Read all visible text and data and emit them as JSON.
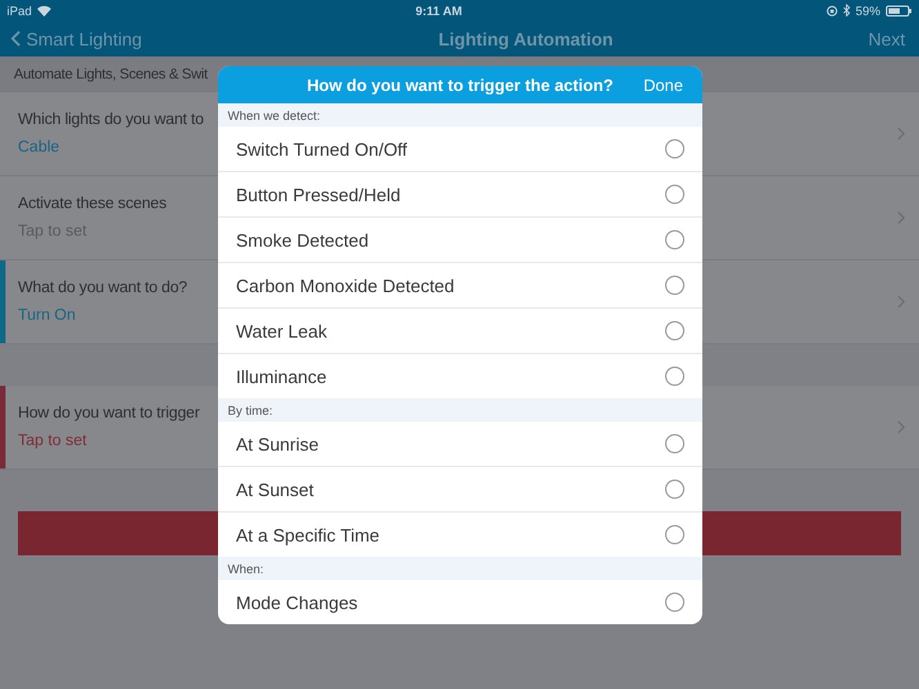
{
  "status_bar": {
    "device": "iPad",
    "time": "9:11 AM",
    "battery": "59%"
  },
  "nav_bar": {
    "back": "Smart Lighting",
    "title": "Lighting Automation",
    "action": "Next"
  },
  "subtitle": "Automate Lights, Scenes & Swit",
  "sections": [
    {
      "rows": [
        {
          "title": "Which lights do you want to",
          "value": "Cable",
          "value_set": true,
          "active": false,
          "error": false
        },
        {
          "title": "Activate these scenes",
          "value": "Tap to set",
          "value_set": false,
          "active": false,
          "error": false
        },
        {
          "title": "What do you want to do?",
          "value": "Turn On",
          "value_set": true,
          "active": true,
          "error": false
        }
      ]
    },
    {
      "rows": [
        {
          "title": "How do you want to trigger",
          "value": "Tap to set",
          "value_set": false,
          "active": false,
          "error": true
        }
      ]
    }
  ],
  "modal": {
    "title": "How do you want to trigger the action?",
    "done": "Done",
    "groups": [
      {
        "heading": "When we detect:",
        "options": [
          {
            "label": "Switch Turned On/Off",
            "selected": false
          },
          {
            "label": "Button Pressed/Held",
            "selected": false
          },
          {
            "label": "Smoke Detected",
            "selected": false
          },
          {
            "label": "Carbon Monoxide Detected",
            "selected": false
          },
          {
            "label": "Water Leak",
            "selected": false
          },
          {
            "label": "Illuminance",
            "selected": false
          }
        ]
      },
      {
        "heading": "By time:",
        "options": [
          {
            "label": "At Sunrise",
            "selected": false
          },
          {
            "label": "At Sunset",
            "selected": false
          },
          {
            "label": "At a Specific Time",
            "selected": false
          }
        ]
      },
      {
        "heading": "When:",
        "options": [
          {
            "label": "Mode Changes",
            "selected": false
          }
        ]
      }
    ]
  }
}
